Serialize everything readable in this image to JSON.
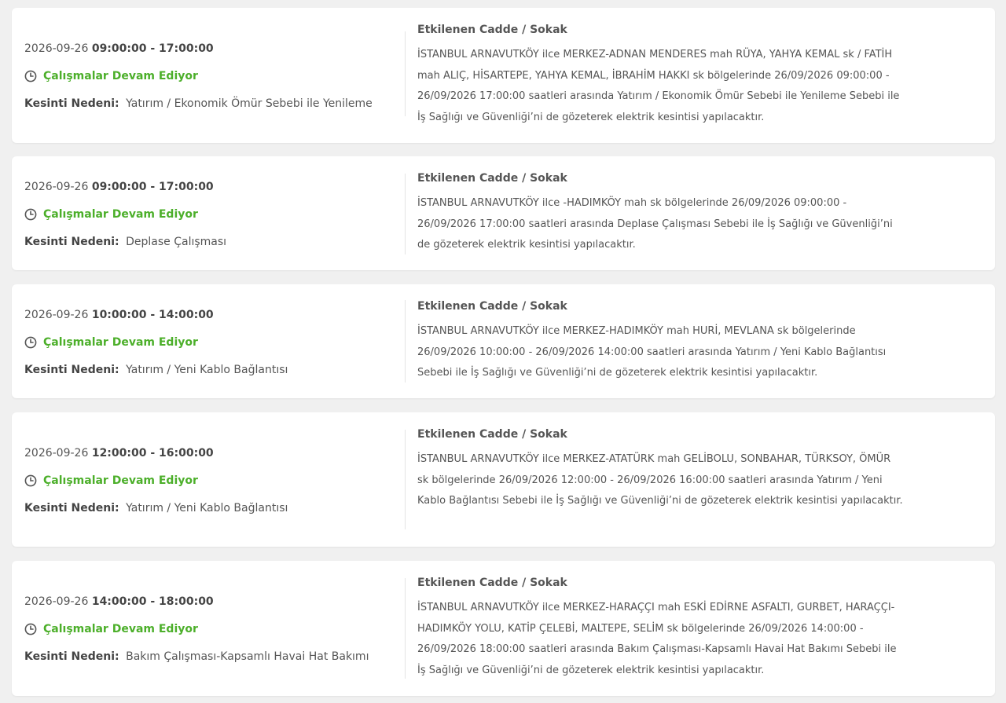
{
  "affected_label": "Etkilenen Cadde / Sokak",
  "reason_label": "Kesinti Nedeni:",
  "status_color": "#4caf2a",
  "outages": [
    {
      "date": "2026-09-26",
      "time": "09:00:00 - 17:00:00",
      "status": "Çalışmalar Devam Ediyor",
      "reason": "Yatırım / Ekonomik Ömür Sebebi ile Yenileme",
      "description": "İSTANBUL ARNAVUTKÖY ilce MERKEZ-ADNAN MENDERES mah RÜYA, YAHYA KEMAL sk / FATİH mah ALIÇ, HİSARTEPE, YAHYA KEMAL, İBRAHİM HAKKI sk bölgelerinde 26/09/2026 09:00:00 - 26/09/2026 17:00:00 saatleri arasında Yatırım / Ekonomik Ömür Sebebi ile Yenileme Sebebi ile İş Sağlığı ve Güvenliği’ni de gözeterek elektrik kesintisi yapılacaktır."
    },
    {
      "date": "2026-09-26",
      "time": "09:00:00 - 17:00:00",
      "status": "Çalışmalar Devam Ediyor",
      "reason": "Deplase Çalışması",
      "description": "İSTANBUL ARNAVUTKÖY ilce -HADIMKÖY mah sk bölgelerinde 26/09/2026 09:00:00 - 26/09/2026 17:00:00 saatleri arasında Deplase Çalışması Sebebi ile İş Sağlığı ve Güvenliği’ni de gözeterek elektrik kesintisi yapılacaktır."
    },
    {
      "date": "2026-09-26",
      "time": "10:00:00 - 14:00:00",
      "status": "Çalışmalar Devam Ediyor",
      "reason": "Yatırım / Yeni Kablo Bağlantısı",
      "description": "İSTANBUL ARNAVUTKÖY ilce MERKEZ-HADIMKÖY mah HURİ, MEVLANA sk bölgelerinde 26/09/2026 10:00:00 - 26/09/2026 14:00:00 saatleri arasında Yatırım / Yeni Kablo Bağlantısı Sebebi ile İş Sağlığı ve Güvenliği’ni de gözeterek elektrik kesintisi yapılacaktır."
    },
    {
      "date": "2026-09-26",
      "time": "12:00:00 - 16:00:00",
      "status": "Çalışmalar Devam Ediyor",
      "reason": "Yatırım / Yeni Kablo Bağlantısı",
      "description": "İSTANBUL ARNAVUTKÖY ilce MERKEZ-ATATÜRK mah GELİBOLU, SONBAHAR, TÜRKSOY, ÖMÜR sk bölgelerinde 26/09/2026 12:00:00 - 26/09/2026 16:00:00 saatleri arasında Yatırım / Yeni Kablo Bağlantısı Sebebi ile İş Sağlığı ve Güvenliği’ni de gözeterek elektrik kesintisi yapılacaktır."
    },
    {
      "date": "2026-09-26",
      "time": "14:00:00 - 18:00:00",
      "status": "Çalışmalar Devam Ediyor",
      "reason": "Bakım Çalışması-Kapsamlı Havai Hat Bakımı",
      "description": "İSTANBUL ARNAVUTKÖY ilce MERKEZ-HARAÇÇI mah ESKİ EDİRNE ASFALTI, GURBET, HARAÇÇI-HADIMKÖY YOLU, KATİP ÇELEBİ, MALTEPE, SELİM sk bölgelerinde 26/09/2026 14:00:00 - 26/09/2026 18:00:00 saatleri arasında Bakım Çalışması-Kapsamlı Havai Hat Bakımı Sebebi ile İş Sağlığı ve Güvenliği’ni de gözeterek elektrik kesintisi yapılacaktır."
    }
  ]
}
